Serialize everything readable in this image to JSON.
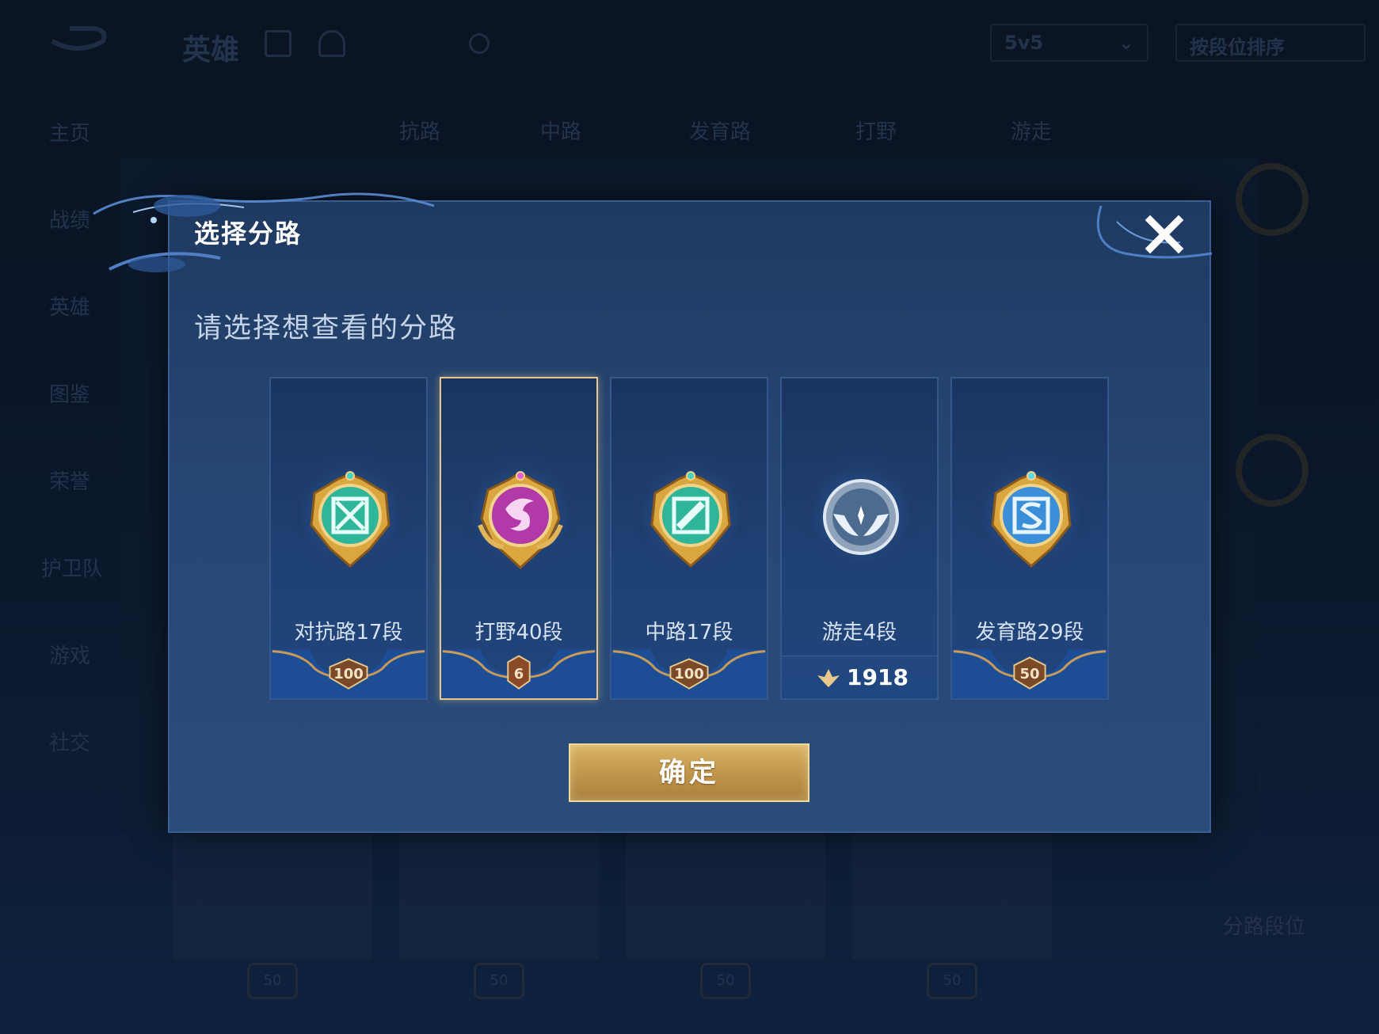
{
  "background": {
    "header_title": "英雄",
    "tool_labels": [
      "",
      ""
    ],
    "mode_select": "5v5",
    "sort_select": "按段位排序",
    "tabs": [
      "抗路",
      "中路",
      "发育路",
      "打野",
      "游走"
    ],
    "side_menu": [
      "主页",
      "战绩",
      "英雄",
      "图鉴",
      "荣誉",
      "护卫队",
      "游戏",
      "社交"
    ],
    "lane_rank_label": "分路段位",
    "bottom_badges": [
      "50",
      "50",
      "50",
      "50"
    ]
  },
  "dialog": {
    "title": "选择分路",
    "subtitle": "请选择想查看的分路",
    "confirm_label": "确定",
    "lanes": [
      {
        "label": "对抗路17段",
        "level": "100",
        "emblem": "clash-lane-emblem",
        "selected": false
      },
      {
        "label": "打野40段",
        "level": "6",
        "emblem": "jungle-dragon-emblem",
        "selected": true
      },
      {
        "label": "中路17段",
        "level": "100",
        "emblem": "mid-lane-emblem",
        "selected": false
      },
      {
        "label": "游走4段",
        "score": "1918",
        "emblem": "roam-wings-emblem",
        "selected": false
      },
      {
        "label": "发育路29段",
        "level": "50",
        "emblem": "farm-lane-emblem",
        "selected": false
      }
    ]
  },
  "colors": {
    "dialog_bg": "#274876",
    "selected_border": "#e7c78b",
    "confirm_gold": "#c39a4f",
    "jungle_purple": "#b23aa8",
    "lane_teal": "#2fb59a",
    "farm_blue": "#3a8fd8"
  }
}
